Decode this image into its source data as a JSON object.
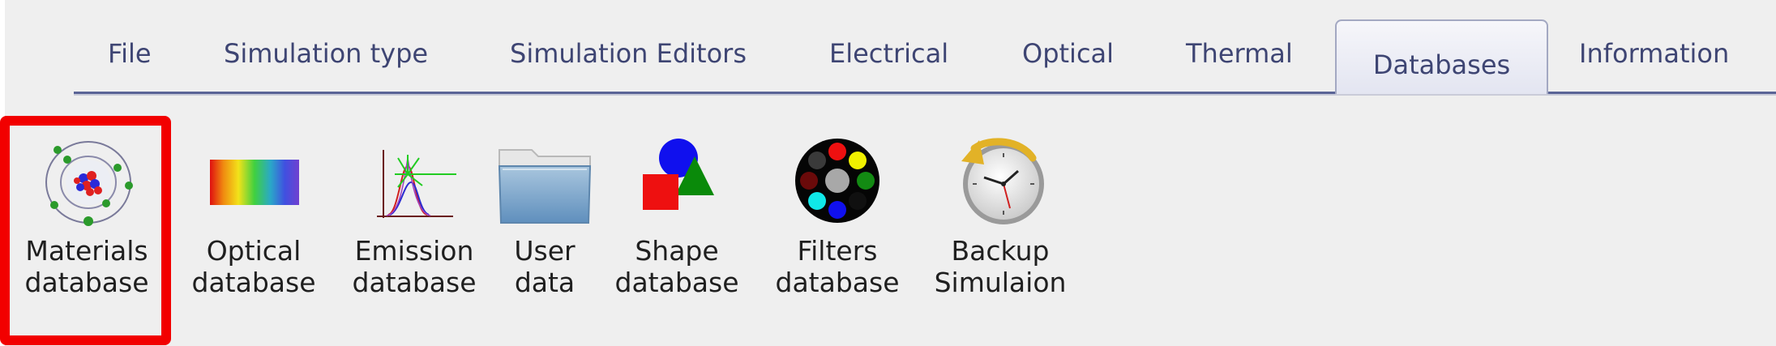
{
  "tabs": [
    {
      "label": "File"
    },
    {
      "label": "Simulation type"
    },
    {
      "label": "Simulation Editors"
    },
    {
      "label": "Electrical"
    },
    {
      "label": "Optical"
    },
    {
      "label": "Thermal"
    },
    {
      "label": "Databases",
      "active": true
    },
    {
      "label": "Information"
    }
  ],
  "ribbon": [
    {
      "line1": "Materials",
      "line2": "database",
      "icon": "atom-icon"
    },
    {
      "line1": "Optical",
      "line2": "database",
      "icon": "spectrum-icon"
    },
    {
      "line1": "Emission",
      "line2": "database",
      "icon": "emission-spectrum-icon"
    },
    {
      "line1": "User",
      "line2": "data",
      "icon": "folder-icon"
    },
    {
      "line1": "Shape",
      "line2": "database",
      "icon": "shapes-icon"
    },
    {
      "line1": "Filters",
      "line2": "database",
      "icon": "color-filter-wheel-icon"
    },
    {
      "line1": "Backup",
      "line2": "Simulaion",
      "icon": "clock-backup-icon"
    }
  ],
  "highlight": {
    "color": "#f20000",
    "target": "Materials database"
  },
  "colors": {
    "tab_text": "#3e4573",
    "tab_line": "#5a6496",
    "background": "#efefef"
  }
}
